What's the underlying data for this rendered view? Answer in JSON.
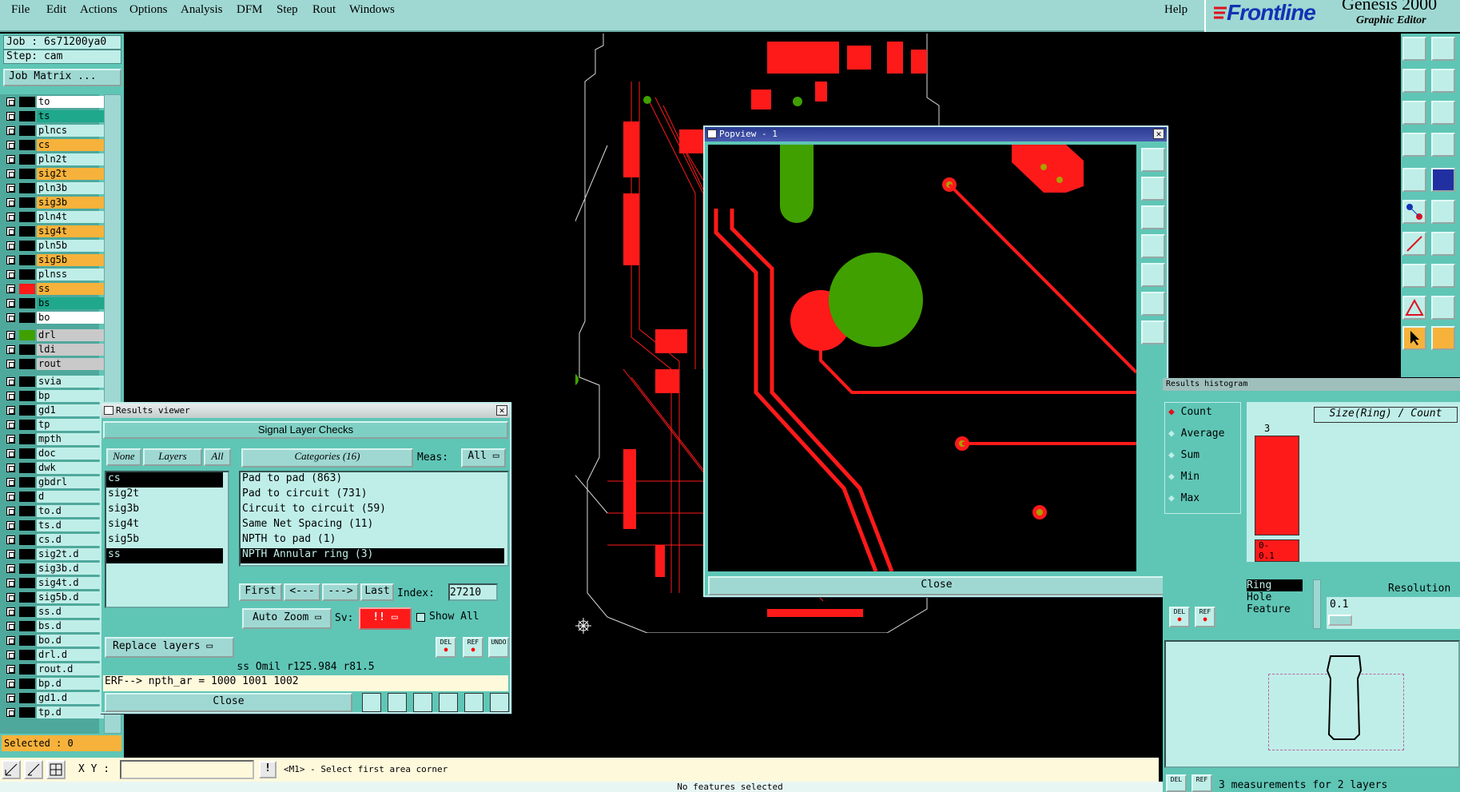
{
  "menu": [
    "File",
    "Edit",
    "Actions",
    "Options",
    "Analysis",
    "DFM",
    "Step",
    "Rout",
    "Windows"
  ],
  "help": "Help",
  "brand": {
    "logo": "Frontline",
    "product": "Genesis 2000",
    "subtitle": "Graphic Editor"
  },
  "job": {
    "job_label": "Job : 6s71200ya0",
    "step_label": "Step: cam",
    "matrix_button": "Job Matrix ..."
  },
  "layers": [
    {
      "name": "to",
      "color": "#ffffff",
      "swatch": "#000000"
    },
    {
      "name": "ts",
      "color": "#1fa88c",
      "swatch": "#000000"
    },
    {
      "name": "plncs",
      "color": "#bfeee8",
      "swatch": "#000000"
    },
    {
      "name": "cs",
      "color": "#f7b23b",
      "swatch": "#000000"
    },
    {
      "name": "pln2t",
      "color": "#bfeee8",
      "swatch": "#000000"
    },
    {
      "name": "sig2t",
      "color": "#f7b23b",
      "swatch": "#000000"
    },
    {
      "name": "pln3b",
      "color": "#bfeee8",
      "swatch": "#000000"
    },
    {
      "name": "sig3b",
      "color": "#f7b23b",
      "swatch": "#000000"
    },
    {
      "name": "pln4t",
      "color": "#bfeee8",
      "swatch": "#000000"
    },
    {
      "name": "sig4t",
      "color": "#f7b23b",
      "swatch": "#000000"
    },
    {
      "name": "pln5b",
      "color": "#bfeee8",
      "swatch": "#000000"
    },
    {
      "name": "sig5b",
      "color": "#f7b23b",
      "swatch": "#000000"
    },
    {
      "name": "plnss",
      "color": "#bfeee8",
      "swatch": "#000000"
    },
    {
      "name": "ss",
      "color": "#f7b23b",
      "swatch": "#ff1a1a"
    },
    {
      "name": "bs",
      "color": "#1fa88c",
      "swatch": "#000000"
    },
    {
      "name": "bo",
      "color": "#ffffff",
      "swatch": "#000000"
    },
    {
      "name": "drl",
      "color": "#c9c9c9",
      "swatch": "#40a000"
    },
    {
      "name": "ldi",
      "color": "#c9c9c9",
      "swatch": "#000000"
    },
    {
      "name": "rout",
      "color": "#c9c9c9",
      "swatch": "#000000"
    },
    {
      "name": "svia",
      "color": "#bfeee8",
      "swatch": "#000000"
    },
    {
      "name": "bp",
      "color": "#bfeee8",
      "swatch": "#000000"
    },
    {
      "name": "gd1",
      "color": "#bfeee8",
      "swatch": "#000000"
    },
    {
      "name": "tp",
      "color": "#bfeee8",
      "swatch": "#000000"
    },
    {
      "name": "mpth",
      "color": "#bfeee8",
      "swatch": "#000000"
    },
    {
      "name": "doc",
      "color": "#bfeee8",
      "swatch": "#000000"
    },
    {
      "name": "dwk",
      "color": "#bfeee8",
      "swatch": "#000000"
    },
    {
      "name": "gbdrl",
      "color": "#bfeee8",
      "swatch": "#000000"
    },
    {
      "name": "d",
      "color": "#bfeee8",
      "swatch": "#000000"
    },
    {
      "name": "to.d",
      "color": "#bfeee8",
      "swatch": "#000000"
    },
    {
      "name": "ts.d",
      "color": "#bfeee8",
      "swatch": "#000000"
    },
    {
      "name": "cs.d",
      "color": "#bfeee8",
      "swatch": "#000000"
    },
    {
      "name": "sig2t.d",
      "color": "#bfeee8",
      "swatch": "#000000"
    },
    {
      "name": "sig3b.d",
      "color": "#bfeee8",
      "swatch": "#000000"
    },
    {
      "name": "sig4t.d",
      "color": "#bfeee8",
      "swatch": "#000000"
    },
    {
      "name": "sig5b.d",
      "color": "#bfeee8",
      "swatch": "#000000"
    },
    {
      "name": "ss.d",
      "color": "#bfeee8",
      "swatch": "#000000"
    },
    {
      "name": "bs.d",
      "color": "#bfeee8",
      "swatch": "#000000"
    },
    {
      "name": "bo.d",
      "color": "#bfeee8",
      "swatch": "#000000"
    },
    {
      "name": "drl.d",
      "color": "#bfeee8",
      "swatch": "#000000"
    },
    {
      "name": "rout.d",
      "color": "#bfeee8",
      "swatch": "#000000"
    },
    {
      "name": "bp.d",
      "color": "#bfeee8",
      "swatch": "#000000"
    },
    {
      "name": "gd1.d",
      "color": "#bfeee8",
      "swatch": "#000000"
    },
    {
      "name": "tp.d",
      "color": "#bfeee8",
      "swatch": "#000000"
    }
  ],
  "selected_label": "Selected : 0",
  "results_viewer": {
    "title": "Results viewer",
    "header": "Signal Layer Checks",
    "none": "None",
    "layers_tab": "Layers",
    "all": "All",
    "categories_tab": "Categories (16)",
    "meas_label": "Meas:",
    "meas_value": "All",
    "layer_list": [
      "cs",
      "sig2t",
      "sig3b",
      "sig4t",
      "sig5b",
      "ss"
    ],
    "categories": [
      "Pad to pad (863)",
      "Pad to circuit (731)",
      "Circuit to circuit (59)",
      "Same Net Spacing (11)",
      "NPTH to pad (1)",
      "NPTH Annular ring (3)"
    ],
    "first": "First",
    "prev": "<---",
    "next": "--->",
    "last": "Last",
    "index_label": "Index:",
    "index_value": "27210",
    "auto_zoom": "Auto Zoom",
    "sv_label": "Sv:",
    "sv_value": "!!",
    "show_all": "Show All",
    "replace_layers": "Replace layers",
    "del": "DEL",
    "ref": "REF",
    "undo": "UNDO",
    "info_line": "ss Omil  r125.984  r81.5",
    "erf_line": "ERF--> npth_ar = 1000 1001 1002",
    "close": "Close"
  },
  "popview": {
    "title": "Popview - 1",
    "close": "Close"
  },
  "histogram": {
    "title": "Results histogram",
    "options": [
      "Count",
      "Average",
      "Sum",
      "Min",
      "Max"
    ],
    "chart_title": "Size(Ring) / Count",
    "bar_value": "3",
    "bar_label": "0-\n0.1",
    "measures": [
      "Ring",
      "Hole",
      "Feature"
    ],
    "resolution_label": "Resolution",
    "resolution_value": "0.1",
    "del": "DEL",
    "ref": "REF",
    "summary": "3 measurements for 2 layers"
  },
  "bottom": {
    "xy_label": "X Y :",
    "xy_value": "",
    "hint": "<M1> - Select first area corner"
  },
  "status": "No features selected"
}
